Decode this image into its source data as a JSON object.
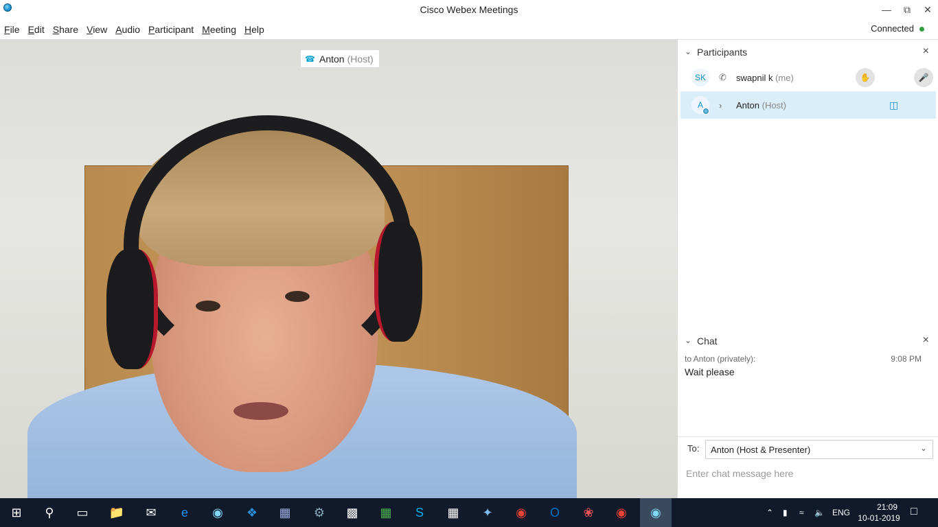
{
  "window": {
    "title": "Cisco Webex Meetings",
    "minimize_icon": "—",
    "restore_icon": "⧉",
    "close_icon": "✕"
  },
  "menu": {
    "items": [
      {
        "label": "File",
        "ul": "F",
        "rest": "ile"
      },
      {
        "label": "Edit",
        "ul": "E",
        "rest": "dit"
      },
      {
        "label": "Share",
        "ul": "S",
        "rest": "hare"
      },
      {
        "label": "View",
        "ul": "V",
        "rest": "iew"
      },
      {
        "label": "Audio",
        "ul": "A",
        "rest": "udio"
      },
      {
        "label": "Participant",
        "ul": "P",
        "rest": "articipant"
      },
      {
        "label": "Meeting",
        "ul": "M",
        "rest": "eeting"
      },
      {
        "label": "Help",
        "ul": "H",
        "rest": "elp"
      }
    ],
    "status": "Connected",
    "status_color": "#2e9e3e"
  },
  "video": {
    "speaker_name": "Anton",
    "speaker_role": "(Host)"
  },
  "participants": {
    "title": "Participants",
    "list": [
      {
        "initials": "SK",
        "name": "swapnil k",
        "tag": "(me)",
        "aux_icon": "phone-icon",
        "aux": "✆"
      },
      {
        "initials": "A",
        "name": "Anton",
        "tag": "(Host)",
        "aux_icon": "chevron-right-icon",
        "aux": "›"
      }
    ]
  },
  "chat": {
    "title": "Chat",
    "message": {
      "meta": "to Anton (privately):",
      "time": "9:08 PM",
      "text": "Wait please"
    },
    "to_label": "To:",
    "to_value": "Anton (Host & Presenter)",
    "placeholder": "Enter chat message here"
  },
  "taskbar": {
    "language": "ENG",
    "time": "21:09",
    "date": "10-01-2019"
  },
  "colors": {
    "accent": "#00a0d1",
    "selected_row": "#d9eef8",
    "taskbar": "#101a2a"
  }
}
